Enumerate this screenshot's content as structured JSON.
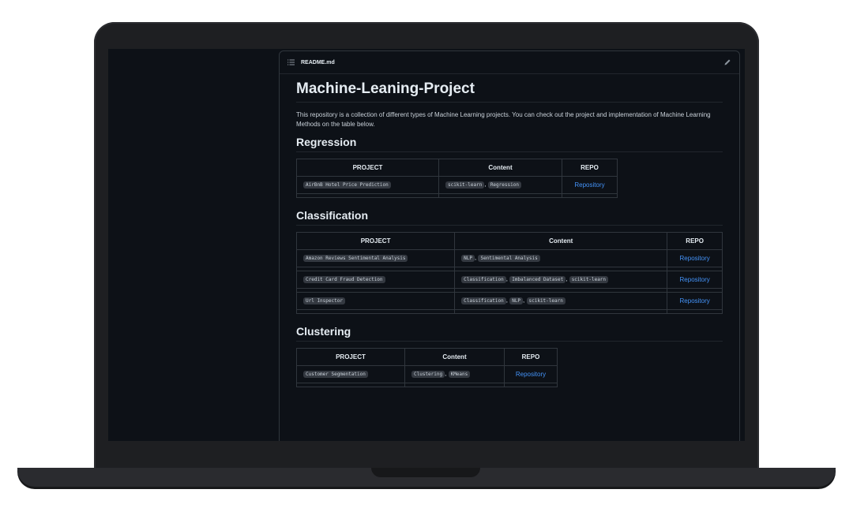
{
  "file": {
    "name": "README.md"
  },
  "title": "Machine-Leaning-Project",
  "intro": "This repository is a collection of different types of Machine Learning projects. You can check out the project and implementation of Machine Learning Methods on the table below.",
  "headers": {
    "project": "PROJECT",
    "content": "Content",
    "repo": "REPO"
  },
  "regression": {
    "heading": "Regression",
    "rows": [
      {
        "project": "AirBnB Hotel Price Prediction",
        "tags": [
          "scikit-learn",
          "Regression"
        ],
        "repo": "Repository"
      }
    ]
  },
  "classification": {
    "heading": "Classification",
    "rows": [
      {
        "project": "Amazon Reviews Sentimental Analysis",
        "tags": [
          "NLP",
          "Sentimental Analysis"
        ],
        "repo": "Repository"
      },
      {
        "project": "Credit Card Fraud Detection",
        "tags": [
          "Classification",
          "Imbalanced Dataset",
          "scikit-learn"
        ],
        "repo": "Repository"
      },
      {
        "project": "Url Inspector",
        "tags": [
          "Classification",
          "NLP",
          "scikit-learn"
        ],
        "repo": "Repository"
      }
    ]
  },
  "clustering": {
    "heading": "Clustering",
    "rows": [
      {
        "project": "Customer Segmentation",
        "tags": [
          "Clustering",
          "KMeans"
        ],
        "repo": "Repository"
      }
    ]
  },
  "colors": {
    "link": "#4493f8",
    "background": "#0d1117",
    "border": "#30363d"
  },
  "icons": {
    "list": "list-icon",
    "edit": "pencil-icon"
  }
}
